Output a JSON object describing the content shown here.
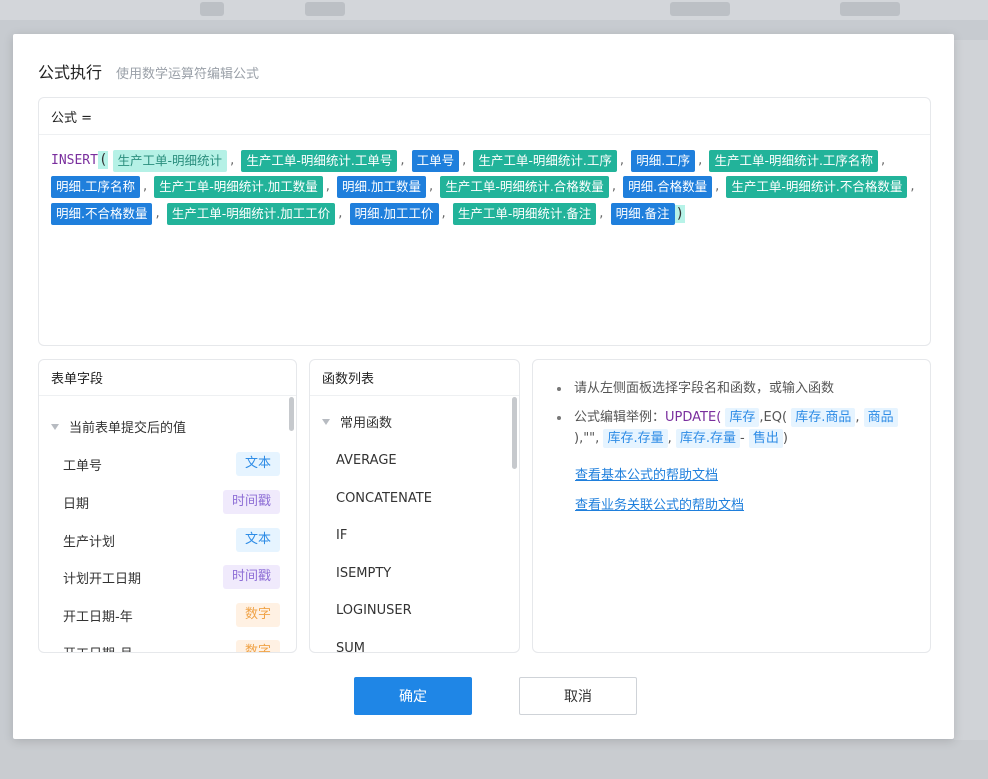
{
  "dialog": {
    "title": "公式执行",
    "subtitle": "使用数学运算符编辑公式"
  },
  "formula": {
    "label": "公式 =",
    "function": "INSERT",
    "tokens": [
      "生产工单-明细统计",
      "生产工单-明细统计.工单号",
      "工单号",
      "生产工单-明细统计.工序",
      "明细.工序",
      "生产工单-明细统计.工序名称",
      "明细.工序名称",
      "生产工单-明细统计.加工数量",
      "明细.加工数量",
      "生产工单-明细统计.合格数量",
      "明细.合格数量",
      "生产工单-明细统计.不合格数量",
      "明细.不合格数量",
      "生产工单-明细统计.加工工价",
      "明细.加工工价",
      "生产工单-明细统计.备注",
      "明细.备注"
    ]
  },
  "fields_panel": {
    "title": "表单字段",
    "group": "当前表单提交后的值",
    "items": [
      {
        "name": "工单号",
        "type": "文本"
      },
      {
        "name": "日期",
        "type": "时间戳"
      },
      {
        "name": "生产计划",
        "type": "文本"
      },
      {
        "name": "计划开工日期",
        "type": "时间戳"
      },
      {
        "name": "开工日期-年",
        "type": "数字"
      },
      {
        "name": "开工日期-月",
        "type": "数字"
      }
    ]
  },
  "functions_panel": {
    "title": "函数列表",
    "group": "常用函数",
    "items": [
      "AVERAGE",
      "CONCATENATE",
      "IF",
      "ISEMPTY",
      "LOGINUSER",
      "SUM"
    ]
  },
  "help_panel": {
    "tip": "请从左侧面板选择字段名和函数，或输入函数",
    "example_prefix": "公式编辑举例：",
    "example_fn1": "UPDATE(",
    "example_tok1": "库存",
    "example_sep1": ",EQ(",
    "example_tok2": "库存.商品",
    "example_sep2": ",",
    "example_tok3": "商品",
    "example_sep3": "),\"\",",
    "example_tok4": "库存.存量",
    "example_sep4": ",",
    "example_tok5": "库存.存量",
    "example_sep5": "-",
    "example_tok6": "售出",
    "example_end": ")",
    "link_basic": "查看基本公式的帮助文档",
    "link_business": "查看业务关联公式的帮助文档"
  },
  "buttons": {
    "confirm": "确定",
    "cancel": "取消"
  }
}
